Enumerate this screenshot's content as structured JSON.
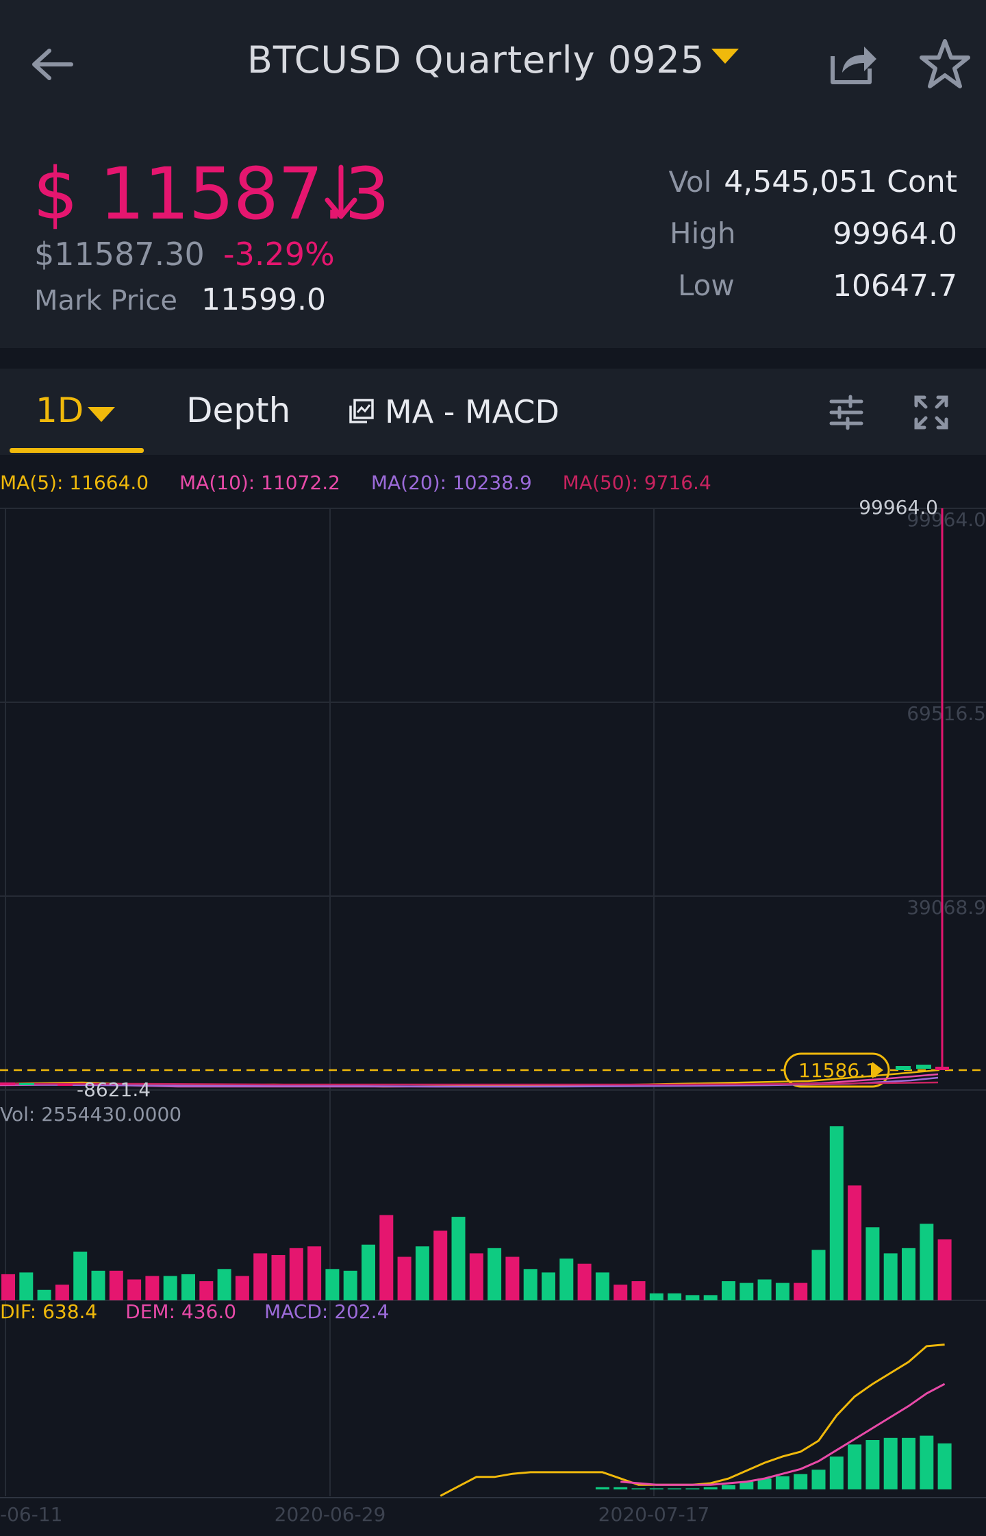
{
  "header": {
    "title": "BTCUSD Quarterly 0925",
    "back_icon": "arrow-left-icon",
    "share_icon": "share-icon",
    "favorite_icon": "star-icon"
  },
  "ticker": {
    "price": "$ 11587.3",
    "price_usd": "$11587.30",
    "change": "-3.29%",
    "mark_price_label": "Mark Price",
    "mark_price": "11599.0",
    "vol_label": "Vol",
    "vol_value": "4,545,051 Cont",
    "high_label": "High",
    "high_value": "99964.0",
    "low_label": "Low",
    "low_value": "10647.7"
  },
  "tabs": {
    "interval": "1D",
    "depth": "Depth",
    "indicators": "MA - MACD"
  },
  "legends": {
    "ma5": "MA(5): 11664.0",
    "ma10": "MA(10): 11072.2",
    "ma20": "MA(20): 10238.9",
    "ma50": "MA(50): 9716.4",
    "vol": "Vol: 2554430.0000",
    "dif": "DIF: 638.4",
    "dem": "DEM: 436.0",
    "macd": "MACD: 202.4"
  },
  "colors": {
    "up": "#0ecb81",
    "down": "#e5166f",
    "accent": "#f0b90b",
    "ma5": "#f0b90b",
    "ma10": "#e84aa8",
    "ma20": "#9c6bd9",
    "ma50": "#c8235f"
  },
  "chart_data": {
    "type": "bar",
    "price_axis_labels": [
      "99964.0",
      "69516.5",
      "39068.9"
    ],
    "max_label": "99964.0",
    "min_label": "-8621.4",
    "current_price_tag": "11586.1",
    "x_tick_labels": [
      "-06-11",
      "2020-06-29",
      "2020-07-17"
    ],
    "volume": {
      "values": [
        0.15,
        0.16,
        0.06,
        0.09,
        0.28,
        0.17,
        0.17,
        0.12,
        0.14,
        0.14,
        0.15,
        0.11,
        0.18,
        0.14,
        0.27,
        0.26,
        0.3,
        0.31,
        0.18,
        0.17,
        0.32,
        0.49,
        0.25,
        0.31,
        0.4,
        0.48,
        0.27,
        0.3,
        0.25,
        0.18,
        0.16,
        0.24,
        0.21,
        0.16,
        0.09,
        0.11,
        0.04,
        0.04,
        0.03,
        0.03,
        0.11,
        0.1,
        0.12,
        0.1,
        0.1,
        0.29,
        1.0,
        0.66,
        0.42,
        0.27,
        0.3,
        0.44,
        0.35
      ],
      "directions": [
        "d",
        "u",
        "u",
        "d",
        "u",
        "u",
        "d",
        "d",
        "d",
        "u",
        "u",
        "d",
        "u",
        "d",
        "d",
        "d",
        "d",
        "d",
        "u",
        "u",
        "u",
        "d",
        "d",
        "u",
        "d",
        "u",
        "d",
        "u",
        "d",
        "u",
        "u",
        "u",
        "d",
        "u",
        "d",
        "d",
        "u",
        "u",
        "u",
        "u",
        "u",
        "u",
        "u",
        "u",
        "d",
        "u",
        "u",
        "d",
        "u",
        "u",
        "u",
        "u",
        "d"
      ]
    },
    "macd": {
      "dif": [
        null,
        null,
        null,
        null,
        null,
        null,
        null,
        null,
        null,
        null,
        null,
        null,
        null,
        null,
        null,
        null,
        null,
        null,
        null,
        null,
        null,
        null,
        null,
        null,
        0.02,
        0.08,
        0.14,
        0.14,
        0.16,
        0.17,
        0.17,
        0.17,
        0.17,
        0.17,
        0.13,
        0.09,
        0.09,
        0.09,
        0.09,
        0.1,
        0.13,
        0.18,
        0.23,
        0.27,
        0.3,
        0.37,
        0.53,
        0.65,
        0.73,
        0.8,
        0.87,
        0.97,
        0.98
      ],
      "dem": [
        null,
        null,
        null,
        null,
        null,
        null,
        null,
        null,
        null,
        null,
        null,
        null,
        null,
        null,
        null,
        null,
        null,
        null,
        null,
        null,
        null,
        null,
        null,
        null,
        null,
        null,
        null,
        null,
        null,
        null,
        null,
        null,
        null,
        null,
        0.11,
        0.1,
        0.09,
        0.09,
        0.09,
        0.09,
        0.1,
        0.11,
        0.13,
        0.16,
        0.19,
        0.24,
        0.31,
        0.38,
        0.45,
        0.52,
        0.59,
        0.67,
        0.73
      ],
      "hist": [
        0,
        0,
        0,
        0,
        0,
        0,
        0,
        0,
        0,
        0,
        0,
        0,
        0,
        0,
        0,
        0,
        0,
        0,
        0,
        0,
        0,
        0,
        0,
        0,
        0,
        0,
        0,
        0,
        0,
        0,
        0,
        0,
        0,
        0.02,
        0.02,
        0.01,
        0.01,
        0.01,
        0.01,
        0.02,
        0.04,
        0.07,
        0.1,
        0.12,
        0.14,
        0.18,
        0.3,
        0.41,
        0.45,
        0.47,
        0.47,
        0.49,
        0.42
      ]
    }
  }
}
